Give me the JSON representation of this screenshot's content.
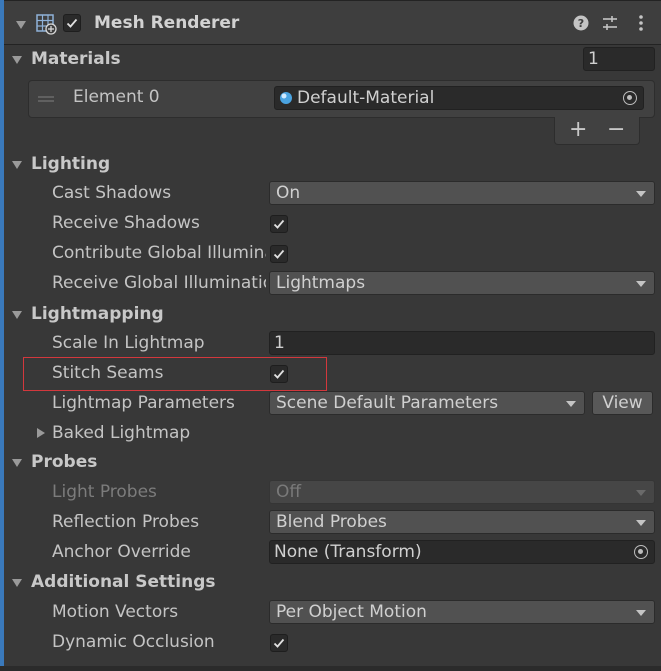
{
  "header": {
    "title": "Mesh Renderer",
    "enabled": true,
    "icons": [
      "mesh-renderer-icon",
      "help-icon",
      "presets-icon",
      "kebab-menu-icon"
    ]
  },
  "materials": {
    "title": "Materials",
    "count": "1",
    "element_label": "Element 0",
    "element_value": "Default-Material",
    "add_label": "+",
    "remove_label": "−"
  },
  "lighting": {
    "title": "Lighting",
    "cast_shadows_label": "Cast Shadows",
    "cast_shadows_value": "On",
    "receive_shadows_label": "Receive Shadows",
    "receive_shadows_checked": true,
    "contribute_gi_label": "Contribute Global Illumination",
    "contribute_gi_checked": true,
    "receive_gi_label": "Receive Global Illumination",
    "receive_gi_value": "Lightmaps"
  },
  "lightmapping": {
    "title": "Lightmapping",
    "scale_label": "Scale In Lightmap",
    "scale_value": "1",
    "stitch_label": "Stitch Seams",
    "stitch_checked": true,
    "params_label": "Lightmap Parameters",
    "params_value": "Scene Default Parameters",
    "view_label": "View",
    "baked_label": "Baked Lightmap"
  },
  "probes": {
    "title": "Probes",
    "light_probes_label": "Light Probes",
    "light_probes_value": "Off",
    "reflection_probes_label": "Reflection Probes",
    "reflection_probes_value": "Blend Probes",
    "anchor_label": "Anchor Override",
    "anchor_value": "None (Transform)"
  },
  "additional": {
    "title": "Additional Settings",
    "motion_label": "Motion Vectors",
    "motion_value": "Per Object Motion",
    "occlusion_label": "Dynamic Occlusion",
    "occlusion_checked": true
  },
  "colors": {
    "background": "#383838",
    "accent_bar": "#3a79bb",
    "highlight": "#d3383d"
  }
}
